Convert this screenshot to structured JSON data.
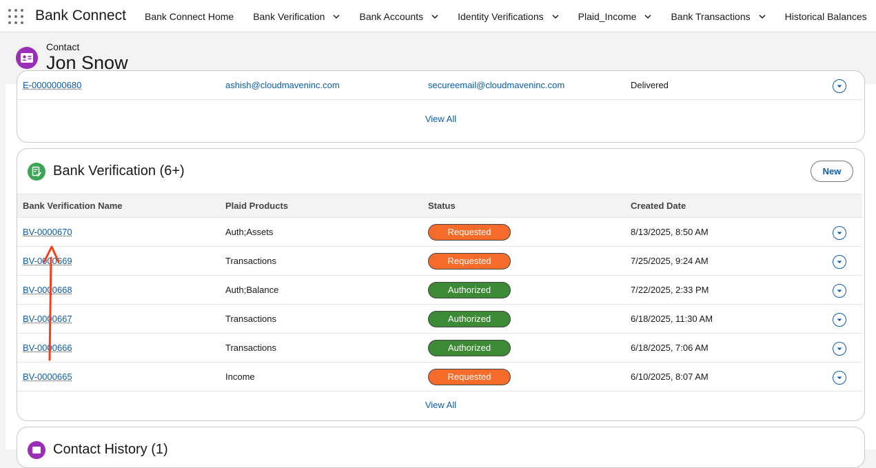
{
  "nav": {
    "app_name": "Bank Connect",
    "items": [
      {
        "label": "Bank Connect Home",
        "dropdown": false
      },
      {
        "label": "Bank Verification",
        "dropdown": true
      },
      {
        "label": "Bank Accounts",
        "dropdown": true
      },
      {
        "label": "Identity Verifications",
        "dropdown": true
      },
      {
        "label": "Plaid_Income",
        "dropdown": true
      },
      {
        "label": "Bank Transactions",
        "dropdown": true
      },
      {
        "label": "Historical Balances",
        "dropdown": false
      }
    ]
  },
  "record": {
    "type": "Contact",
    "name": "Jon Snow"
  },
  "email_card": {
    "row": {
      "id": "E-0000000680",
      "from": "ashish@cloudmaveninc.com",
      "to": "secureemail@cloudmaveninc.com",
      "status": "Delivered"
    },
    "view_all": "View All"
  },
  "bv_card": {
    "title": "Bank Verification (6+)",
    "new_label": "New",
    "columns": [
      "Bank Verification Name",
      "Plaid Products",
      "Status",
      "Created Date"
    ],
    "rows": [
      {
        "name": "BV-0000670",
        "products": "Auth;Assets",
        "status": "Requested",
        "created": "8/13/2025, 8:50 AM"
      },
      {
        "name": "BV-0000669",
        "products": "Transactions",
        "status": "Requested",
        "created": "7/25/2025, 9:24 AM"
      },
      {
        "name": "BV-0000668",
        "products": "Auth;Balance",
        "status": "Authorized",
        "created": "7/22/2025, 2:33 PM"
      },
      {
        "name": "BV-0000667",
        "products": "Transactions",
        "status": "Authorized",
        "created": "6/18/2025, 11:30 AM"
      },
      {
        "name": "BV-0000666",
        "products": "Transactions",
        "status": "Authorized",
        "created": "6/18/2025, 7:06 AM"
      },
      {
        "name": "BV-0000665",
        "products": "Income",
        "status": "Requested",
        "created": "6/10/2025, 8:07 AM"
      }
    ],
    "view_all": "View All"
  },
  "history_card": {
    "title": "Contact History (1)"
  },
  "colors": {
    "link": "#0b5cab",
    "requested": "#f46b2a",
    "authorized": "#3c8a35",
    "contact_icon": "#9a2fb5",
    "bv_icon": "#3ba755",
    "annotation_arrow": "#f2401f"
  },
  "icons": {
    "app_launcher": "waffle-icon",
    "record": "contact-card-icon",
    "bv": "document-check-icon",
    "row_action": "chevron-down-circle-icon"
  }
}
